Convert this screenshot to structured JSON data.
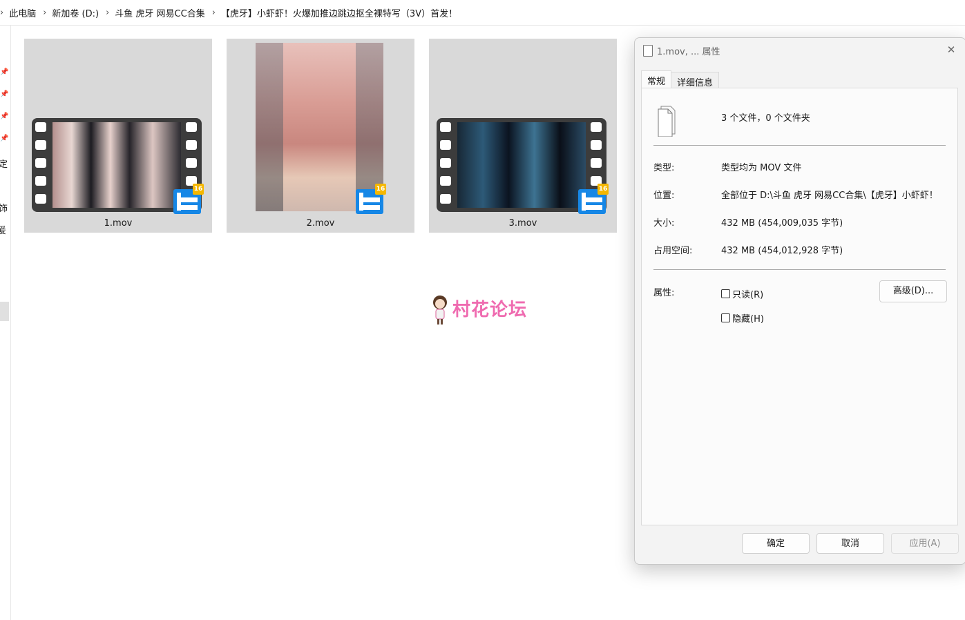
{
  "breadcrumb": {
    "items": [
      "此电脑",
      "新加卷 (D:)",
      "斗鱼 虎牙 网易CC合集",
      "【虎牙】小虾虾！火爆加推边跳边抠全裸特写（3V）首发！"
    ]
  },
  "leftnav": {
    "fragments": [
      "定",
      "饰",
      "爰"
    ]
  },
  "files": [
    {
      "name": "1.mov"
    },
    {
      "name": "2.mov"
    },
    {
      "name": "3.mov"
    }
  ],
  "watermark": {
    "text": "村花论坛"
  },
  "dialog": {
    "title": "1.mov, ... 属性",
    "tabs": [
      "常规",
      "详细信息"
    ],
    "summary": "3 个文件，0 个文件夹",
    "type_label": "类型:",
    "type_value": "类型均为 MOV 文件",
    "location_label": "位置:",
    "location_value": "全部位于 D:\\斗鱼 虎牙 网易CC合集\\【虎牙】小虾虾！",
    "size_label": "大小:",
    "size_value": "432 MB (454,009,035 字节)",
    "disk_label": "占用空间:",
    "disk_value": "432 MB (454,012,928 字节)",
    "attr_label": "属性:",
    "readonly_label": "只读(R)",
    "hidden_label": "隐藏(H)",
    "advanced_button": "高级(D)...",
    "ok_button": "确定",
    "cancel_button": "取消",
    "apply_button": "应用(A)"
  }
}
